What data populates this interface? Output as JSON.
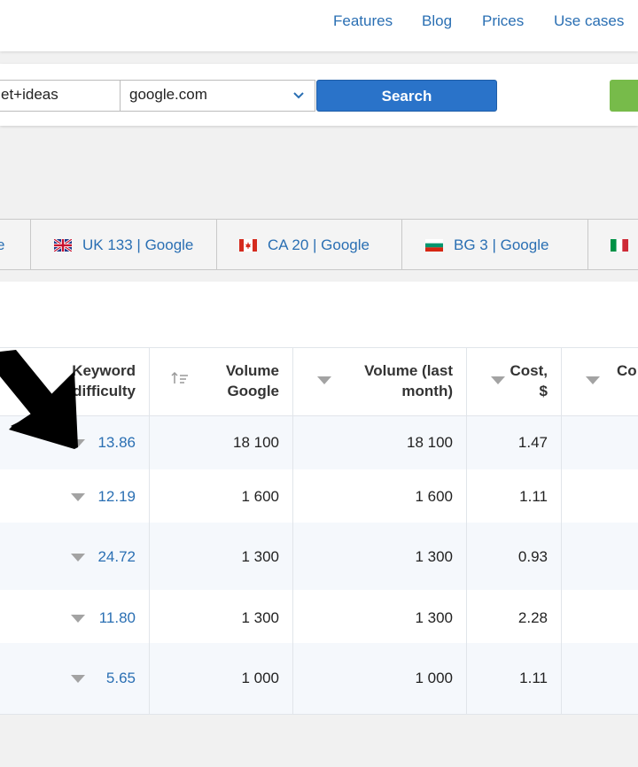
{
  "nav": {
    "items": [
      "Features",
      "Blog",
      "Prices",
      "Use cases"
    ]
  },
  "search": {
    "keyword_value": "et+ideas",
    "database_value": "google.com",
    "search_label": "Search"
  },
  "tabs": [
    {
      "label": "e"
    },
    {
      "label": "UK 133 | Google",
      "flag": "uk-flag-icon"
    },
    {
      "label": "CA 20 | Google",
      "flag": "canada-flag-icon"
    },
    {
      "label": "BG 3 | Google",
      "flag": "bulgaria-flag-icon"
    },
    {
      "label": "",
      "flag": "italy-flag-icon"
    }
  ],
  "table": {
    "headers": {
      "kd_line1": "Keyword",
      "kd_line2": "difficulty",
      "vol_google_line1": "Volume",
      "vol_google_line2": "Google",
      "vol_last_line1": "Volume (last",
      "vol_last_line2": "month)",
      "cost_line1": "Cost,",
      "cost_line2": "$",
      "comp": "Co"
    },
    "rows": [
      {
        "kd": "13.86",
        "vol_google": "18 100",
        "vol_last": "18 100",
        "cost": "1.47"
      },
      {
        "kd": "12.19",
        "vol_google": "1 600",
        "vol_last": "1 600",
        "cost": "1.11"
      },
      {
        "kd": "24.72",
        "vol_google": "1 300",
        "vol_last": "1 300",
        "cost": "0.93"
      },
      {
        "kd": "11.80",
        "vol_google": "1 300",
        "vol_last": "1 300",
        "cost": "2.28"
      },
      {
        "kd": "5.65",
        "vol_google": "1 000",
        "vol_last": "1 000",
        "cost": "1.11"
      }
    ]
  },
  "colors": {
    "link": "#2a6fb3",
    "search_button": "#2a73c9",
    "accent_green": "#77bb4a",
    "row_alt": "#f5f8fc"
  }
}
